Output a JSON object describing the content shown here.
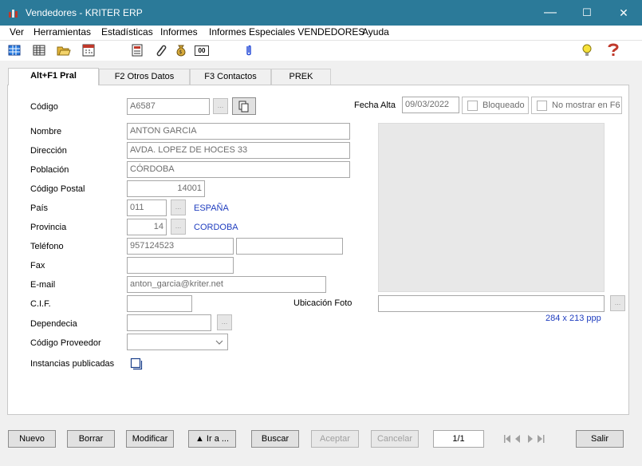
{
  "window": {
    "title": "Vendedores - KRITER ERP",
    "minimize": "—",
    "maximize": "☐",
    "close": "✕"
  },
  "menu": [
    "Ver",
    "Herramientas",
    "Estadísticas",
    "Informes",
    "Informes Especiales VENDEDORES",
    "Ayuda"
  ],
  "toolbar_icons": [
    "table-icon",
    "grid-icon",
    "folder-open-icon",
    "calendar-icon",
    "document-icon",
    "paperclip-icon",
    "money-bag-icon",
    "counter-icon",
    "attachment-icon",
    "lightbulb-icon",
    "help-icon"
  ],
  "counter_icon_text": "00",
  "tabs": [
    "Alt+F1 Pral",
    "F2 Otros Datos",
    "F3 Contactos",
    "PREK"
  ],
  "form": {
    "codigo_label": "Código",
    "codigo": "A6587",
    "fecha_alta_label": "Fecha Alta",
    "fecha_alta": "09/03/2022",
    "bloqueado_label": "Bloqueado",
    "no_mostrar_label": "No mostrar en F6",
    "nombre_label": "Nombre",
    "nombre": "ANTON GARCIA",
    "direccion_label": "Dirección",
    "direccion": "AVDA. LOPEZ DE HOCES 33",
    "poblacion_label": "Población",
    "poblacion": "CÓRDOBA",
    "cp_label": "Código Postal",
    "cp": "14001",
    "pais_label": "País",
    "pais_code": "011",
    "pais_name": "ESPAÑA",
    "provincia_label": "Provincia",
    "provincia_code": "14",
    "provincia_name": "CORDOBA",
    "telefono_label": "Teléfono",
    "telefono": "957124523",
    "telefono2": "",
    "fax_label": "Fax",
    "fax": "",
    "email_label": "E-mail",
    "email": "anton_garcia@kriter.net",
    "cif_label": "C.I.F.",
    "cif": "",
    "dependencia_label": "Dependecia",
    "dependencia": "",
    "proveedor_label": "Código Proveedor",
    "proveedor": "",
    "instancias_label": "Instancias publicadas",
    "ubicacion_label": "Ubicación Foto",
    "ubicacion": "",
    "photo_size": "284 x 213 ppp",
    "dots": "..."
  },
  "buttons": {
    "nuevo": "Nuevo",
    "borrar": "Borrar",
    "modificar": "Modificar",
    "ira": "▲ Ir a ...",
    "buscar": "Buscar",
    "aceptar": "Aceptar",
    "cancelar": "Cancelar",
    "salir": "Salir"
  },
  "record_counter": "1/1",
  "colors": {
    "titlebar": "#2b7a99",
    "link_blue": "#1f3dbf",
    "panel": "#f0f0f0"
  }
}
